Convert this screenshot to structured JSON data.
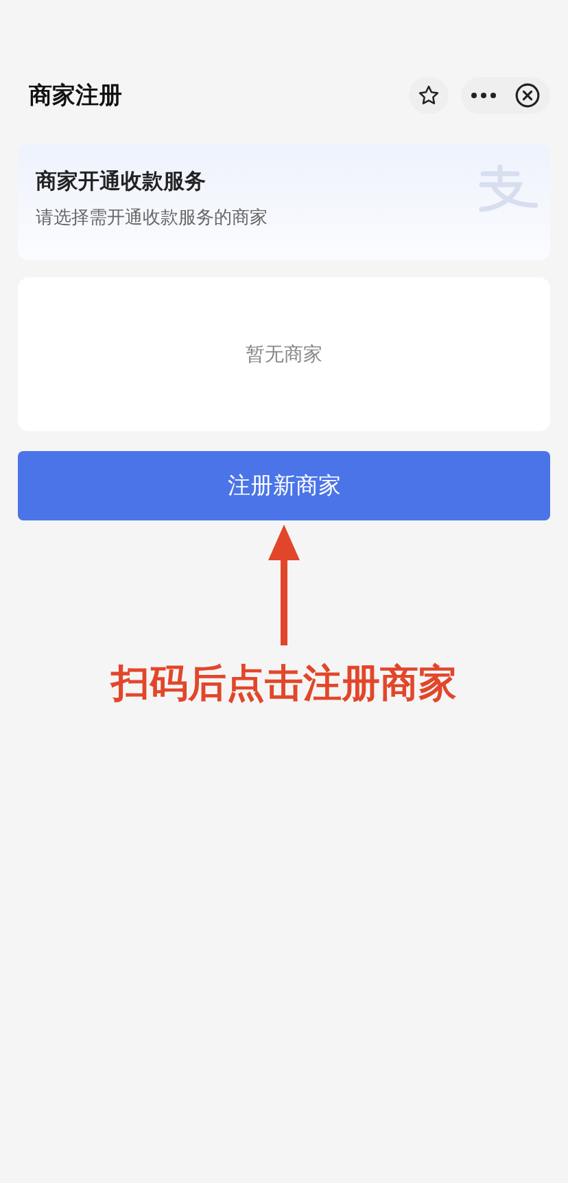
{
  "header": {
    "title": "商家注册"
  },
  "intro_card": {
    "title": "商家开通收款服务",
    "subtitle": "请选择需开通收款服务的商家"
  },
  "merchant_list": {
    "empty_text": "暂无商家"
  },
  "register_button": {
    "label": "注册新商家"
  },
  "annotation": {
    "text": "扫码后点击注册商家"
  }
}
